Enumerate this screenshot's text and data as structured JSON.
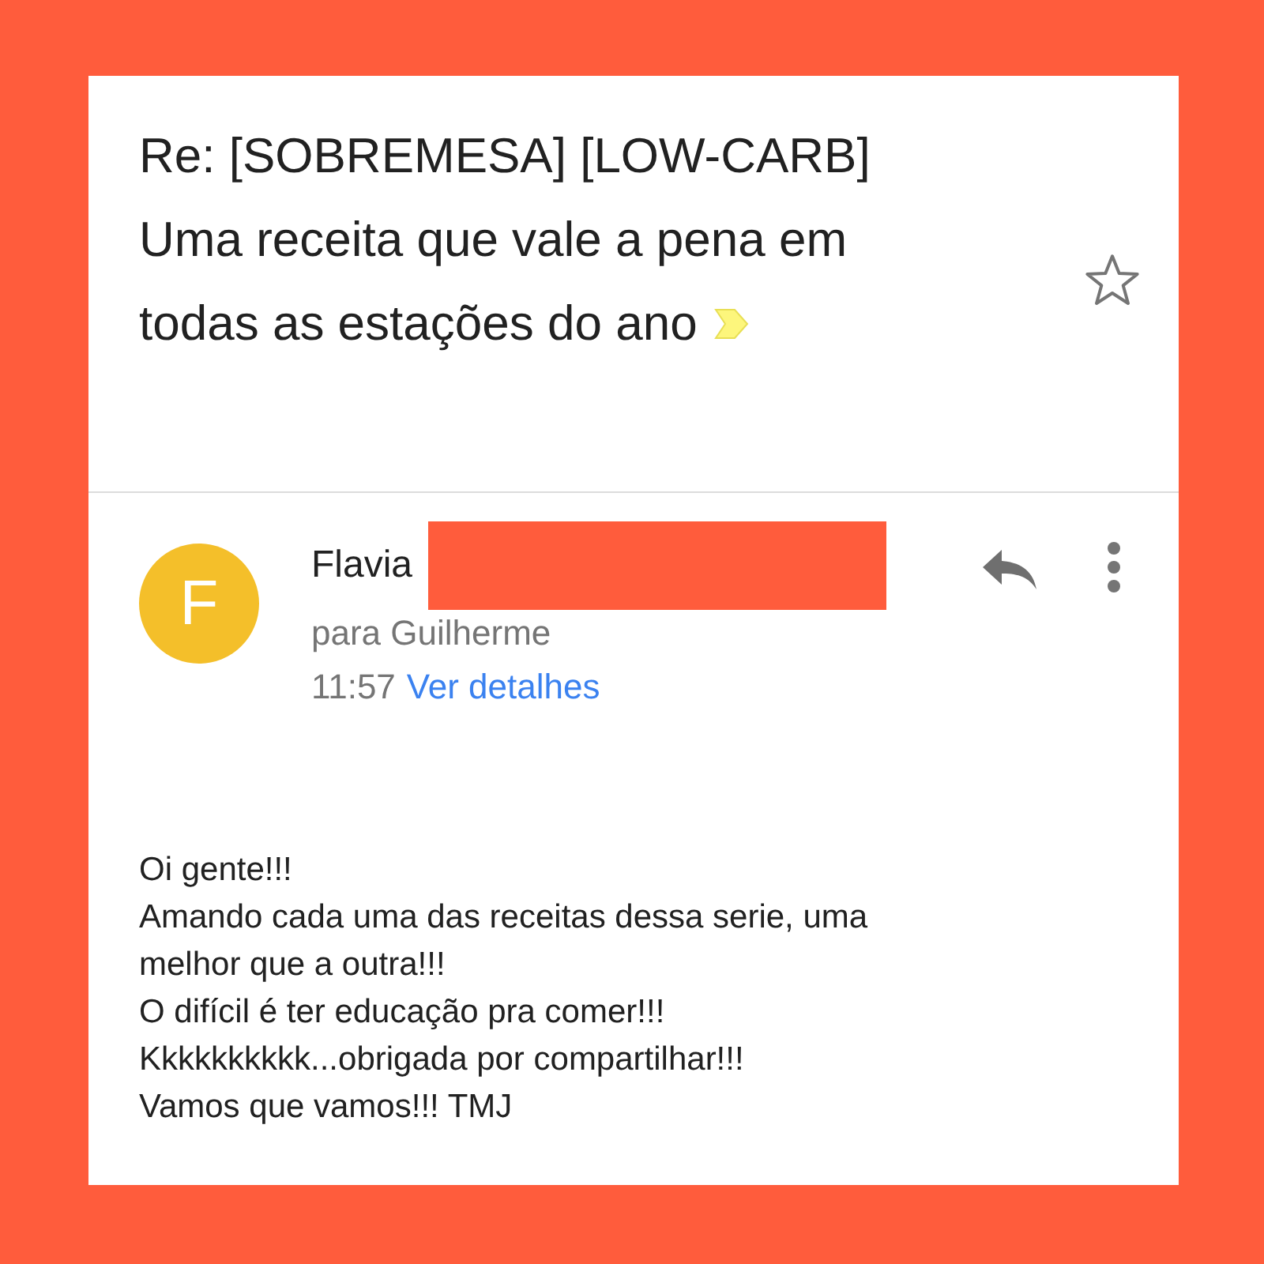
{
  "subject": {
    "lines": [
      "Re: [SOBREMESA] [LOW-CARB]",
      "Uma receita que vale a pena em",
      "todas as estações do ano"
    ],
    "important": true,
    "starred": false
  },
  "message": {
    "avatar_letter": "F",
    "sender": "Flavia",
    "sender_redacted": true,
    "recipient": "para Guilherme",
    "time": "11:57",
    "details_link": "Ver detalhes"
  },
  "body": [
    "Oi gente!!!",
    "Amando cada uma das receitas dessa serie, uma",
    "melhor que a outra!!!",
    "O difícil é ter educação pra comer!!!",
    "Kkkkkkkkkk...obrigada por compartilhar!!!",
    "Vamos que vamos!!! TMJ"
  ]
}
